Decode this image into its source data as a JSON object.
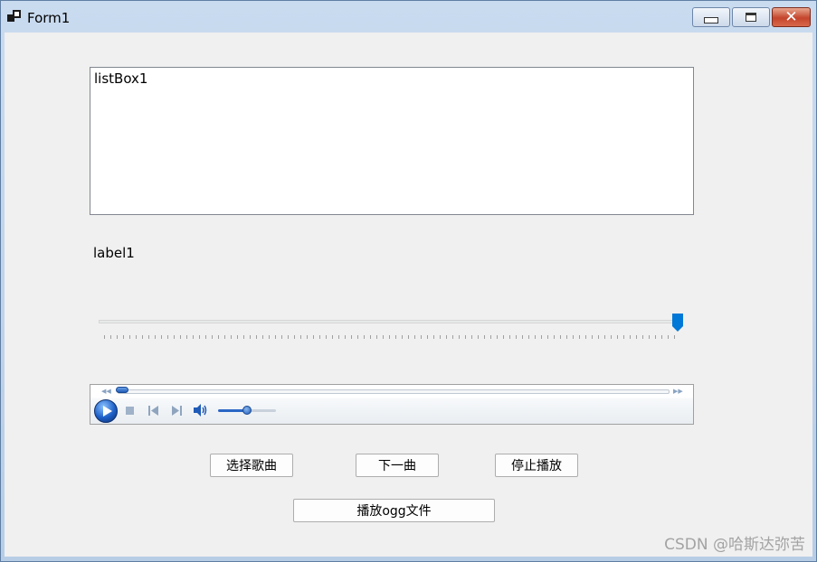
{
  "window": {
    "title": "Form1"
  },
  "listbox": {
    "items": [
      "listBox1"
    ]
  },
  "label1": {
    "text": "label1"
  },
  "trackbar": {
    "value_fraction": 1.0
  },
  "media_player": {
    "position_fraction": 0.0,
    "volume_fraction": 0.5
  },
  "buttons": {
    "select_song": "选择歌曲",
    "next_song": "下一曲",
    "stop_play": "停止播放",
    "play_ogg": "播放ogg文件"
  },
  "watermark": "CSDN @哈斯达弥苦",
  "icons": [
    "app-icon",
    "minimize-icon",
    "maximize-icon",
    "close-icon",
    "play-icon",
    "stop-icon",
    "previous-icon",
    "next-icon",
    "volume-icon",
    "rewind-icon",
    "fast-forward-icon"
  ],
  "colors": {
    "accent": "#0078d7",
    "client_bg": "#f0f0f0",
    "close_button": "#c4452c"
  }
}
